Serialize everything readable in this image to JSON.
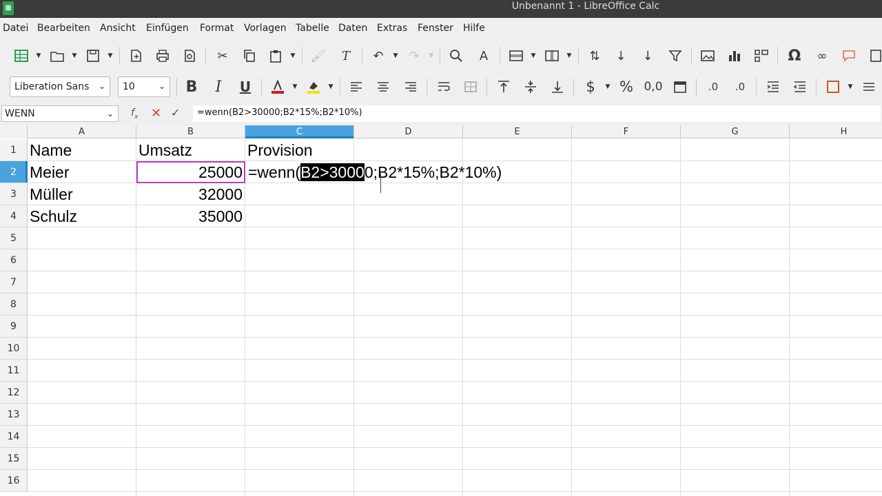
{
  "window": {
    "title": "Unbenannt 1 - LibreOffice Calc"
  },
  "menu": [
    "Datei",
    "Bearbeiten",
    "Ansicht",
    "Einfügen",
    "Format",
    "Vorlagen",
    "Tabelle",
    "Daten",
    "Extras",
    "Fenster",
    "Hilfe"
  ],
  "formatting": {
    "font_name": "Liberation Sans",
    "font_size": "10"
  },
  "formula_bar": {
    "name_box": "WENN",
    "formula": "=wenn(B2>30000;B2*15%;B2*10%)"
  },
  "sheet": {
    "columns": [
      "A",
      "B",
      "C",
      "D",
      "E",
      "F",
      "G",
      "H"
    ],
    "rows": [
      "1",
      "2",
      "3",
      "4",
      "5",
      "6",
      "7",
      "8",
      "9",
      "10",
      "11",
      "12",
      "13",
      "14",
      "15",
      "16"
    ],
    "active_column": "C",
    "active_row": "2",
    "cells": {
      "a1": "Name",
      "b1": "Umsatz",
      "c1": "Provision",
      "a2": "Meier",
      "b2": "25000",
      "a3": "Müller",
      "b3": "32000",
      "a4": "Schulz",
      "b4": "35000"
    },
    "editing": {
      "before": "=wenn(",
      "selected": "B2>3000",
      "after": "0;B2*15%;B2*10%)"
    }
  },
  "colors": {
    "accent": "#4aa3df",
    "reference_frame": "#b63ec4",
    "cancel": "#d9402a"
  }
}
